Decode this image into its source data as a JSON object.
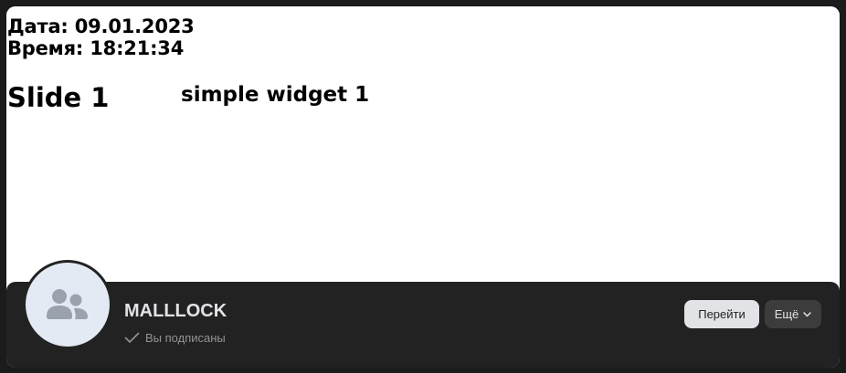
{
  "slide": {
    "date_line": "Дата: 09.01.2023",
    "time_line": "Время: 18:21:34",
    "title": "Slide 1",
    "widget_title": "simple widget 1"
  },
  "community": {
    "name": "MALLLOCK",
    "status": "Вы подписаны",
    "avatar_icon": "users-icon",
    "status_icon": "checkmark-icon"
  },
  "actions": {
    "go_label": "Перейти",
    "more_label": "Ещё",
    "more_icon": "chevron-down-icon"
  },
  "colors": {
    "page_background": "#1b1b1b",
    "bar_background": "#222222",
    "avatar_background": "#e3eaf3",
    "avatar_icon": "#99a2ad",
    "primary_button": "#e1e3e6",
    "secondary_button": "#3c3c3c",
    "muted_text": "#939393"
  }
}
